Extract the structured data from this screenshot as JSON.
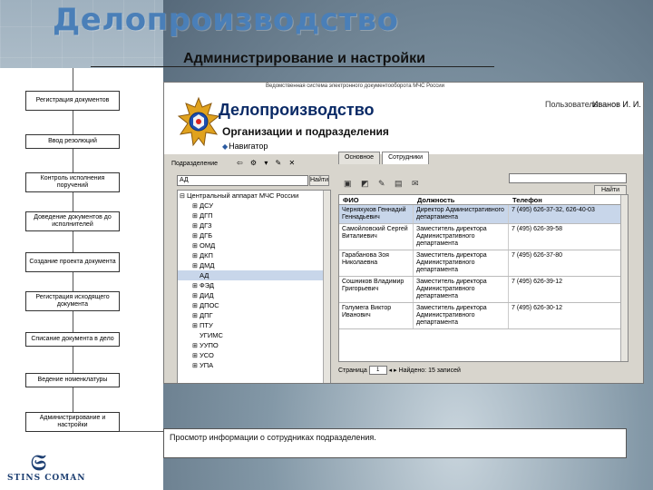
{
  "slide": {
    "title": "Делопроизводство",
    "subtitle": "Администрирование и настройки"
  },
  "left_nav": [
    {
      "label": "Регистрация документов"
    },
    {
      "label": "Ввод резолюций"
    },
    {
      "label": "Контроль исполнения поручений"
    },
    {
      "label": "Доведение документов до исполнителей"
    },
    {
      "label": "Создание проекта документа"
    },
    {
      "label": "Регистрация исходящего документа"
    },
    {
      "label": "Списание документа в дело"
    },
    {
      "label": "Ведение номенклатуры"
    },
    {
      "label": "Администрирование и настройки"
    }
  ],
  "company": {
    "mark": "𝔖",
    "name": "STINS COMAN"
  },
  "app": {
    "topbar_text": "Ведомственная система электронного документооборота МЧС России",
    "title": "Делопроизводство",
    "section": "Организации и подразделения",
    "nav_link": "Навигатор",
    "user_label": "Пользователь:",
    "user_name": "Иванов И. И.",
    "left": {
      "label": "Подразделение",
      "tools": "⇦ ⚙ ▾ ✎ ✕",
      "search_value": "АД",
      "find_button": "Найти",
      "tree": [
        {
          "exp": "⊟",
          "label": "Центральный аппарат МЧС России",
          "indent": 0,
          "selected": false
        },
        {
          "exp": "⊞",
          "label": "ДСУ",
          "indent": 1,
          "selected": false
        },
        {
          "exp": "⊞",
          "label": "ДГП",
          "indent": 1,
          "selected": false
        },
        {
          "exp": "⊞",
          "label": "ДГЗ",
          "indent": 1,
          "selected": false
        },
        {
          "exp": "⊞",
          "label": "ДГБ",
          "indent": 1,
          "selected": false
        },
        {
          "exp": "⊞",
          "label": "ОМД",
          "indent": 1,
          "selected": false
        },
        {
          "exp": "⊞",
          "label": "ДКП",
          "indent": 1,
          "selected": false
        },
        {
          "exp": "⊞",
          "label": "ДМД",
          "indent": 1,
          "selected": false
        },
        {
          "exp": "",
          "label": "АД",
          "indent": 1,
          "selected": true
        },
        {
          "exp": "⊞",
          "label": "ФЭД",
          "indent": 1,
          "selected": false
        },
        {
          "exp": "⊞",
          "label": "ДИД",
          "indent": 1,
          "selected": false
        },
        {
          "exp": "⊞",
          "label": "ДПОС",
          "indent": 1,
          "selected": false
        },
        {
          "exp": "⊞",
          "label": "ДПГ",
          "indent": 1,
          "selected": false
        },
        {
          "exp": "⊞",
          "label": "ПТУ",
          "indent": 1,
          "selected": false
        },
        {
          "exp": "",
          "label": "УГИМС",
          "indent": 1,
          "selected": false
        },
        {
          "exp": "⊞",
          "label": "УУПО",
          "indent": 1,
          "selected": false
        },
        {
          "exp": "⊞",
          "label": "УСО",
          "indent": 1,
          "selected": false
        },
        {
          "exp": "⊞",
          "label": "УПА",
          "indent": 1,
          "selected": false
        }
      ]
    },
    "right": {
      "tabs": [
        {
          "label": "Основное",
          "active": false
        },
        {
          "label": "Сотрудники",
          "active": true
        }
      ],
      "find_button": "Найти",
      "toolbar": "▣ ◩ ✎ ▤ ✉",
      "columns": [
        "ФИО",
        "Должность",
        "Телефон"
      ],
      "rows": [
        {
          "fio": "Черняхуков Геннадий Геннадьевич",
          "position": "Директор Административного департамента",
          "phone": "7 (495) 626-37-32, 626-40-03",
          "selected": true
        },
        {
          "fio": "Самойловский Сергей Виталиевич",
          "position": "Заместитель директора Административного департамента",
          "phone": "7 (495) 626-39-58",
          "selected": false
        },
        {
          "fio": "Гарабанова Зоя Николаевна",
          "position": "Заместитель директора Административного департамента",
          "phone": "7 (495) 626-37-80",
          "selected": false
        },
        {
          "fio": "Сошников Владимир Григорьевич",
          "position": "Заместитель директора Административного департамента",
          "phone": "7 (495) 626-39-12",
          "selected": false
        },
        {
          "fio": "Голумега Виктор Иванович",
          "position": "Заместитель директора Административного департамента",
          "phone": "7 (495) 626-30-12",
          "selected": false
        }
      ],
      "pager": {
        "label": "Страница",
        "value": "1",
        "of_text": "Найдено: 15 записей"
      }
    }
  },
  "caption": "Просмотр информации о сотрудниках подразделения."
}
